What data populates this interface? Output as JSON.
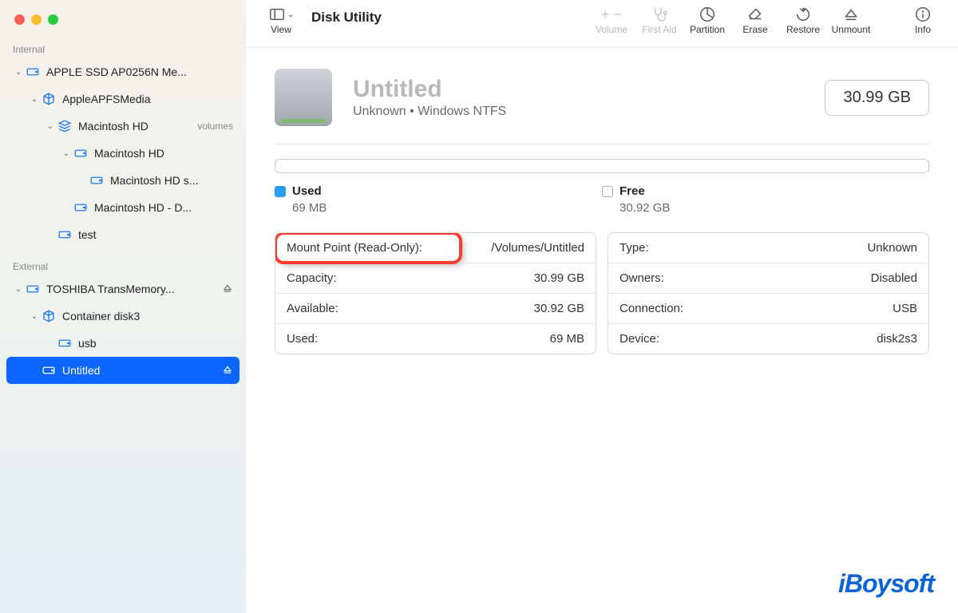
{
  "window": {
    "title": "Disk Utility"
  },
  "toolbar": {
    "view": "View",
    "volume": "Volume",
    "firstaid": "First Aid",
    "partition": "Partition",
    "erase": "Erase",
    "restore": "Restore",
    "unmount": "Unmount",
    "info": "Info"
  },
  "sidebar": {
    "internal_label": "Internal",
    "external_label": "External",
    "internal": [
      {
        "l": 0,
        "chev": true,
        "icon": "disk",
        "label": "APPLE SSD AP0256N Me..."
      },
      {
        "l": 1,
        "chev": true,
        "icon": "cube",
        "label": "AppleAPFSMedia"
      },
      {
        "l": 2,
        "chev": true,
        "icon": "stack",
        "label": "Macintosh HD",
        "sub": "volumes"
      },
      {
        "l": 3,
        "chev": true,
        "icon": "disk",
        "label": "Macintosh HD"
      },
      {
        "l": 4,
        "chev": false,
        "icon": "disk",
        "label": "Macintosh HD  s..."
      },
      {
        "l": 3,
        "chev": false,
        "icon": "disk",
        "label": "Macintosh HD - D..."
      },
      {
        "l": 2,
        "chev": false,
        "icon": "disk",
        "label": "test"
      }
    ],
    "external": [
      {
        "l": 0,
        "chev": true,
        "icon": "disk",
        "label": "TOSHIBA TransMemory...",
        "eject": true
      },
      {
        "l": 1,
        "chev": true,
        "icon": "cube",
        "label": "Container disk3"
      },
      {
        "l": 2,
        "chev": false,
        "icon": "disk",
        "label": "usb"
      },
      {
        "l": 1,
        "chev": false,
        "icon": "disk",
        "label": "Untitled",
        "eject": true,
        "selected": true
      }
    ]
  },
  "detail": {
    "name": "Untitled",
    "sub": "Unknown • Windows NTFS",
    "capacity_box": "30.99 GB",
    "used_label": "Used",
    "used_value": "69 MB",
    "free_label": "Free",
    "free_value": "30.92 GB",
    "left": [
      {
        "k": "Mount Point (Read-Only):",
        "v": "/Volumes/Untitled",
        "hl": true
      },
      {
        "k": "Capacity:",
        "v": "30.99 GB"
      },
      {
        "k": "Available:",
        "v": "30.92 GB"
      },
      {
        "k": "Used:",
        "v": "69 MB"
      }
    ],
    "right": [
      {
        "k": "Type:",
        "v": "Unknown"
      },
      {
        "k": "Owners:",
        "v": "Disabled"
      },
      {
        "k": "Connection:",
        "v": "USB"
      },
      {
        "k": "Device:",
        "v": "disk2s3"
      }
    ]
  },
  "brand": "iBoysoft"
}
